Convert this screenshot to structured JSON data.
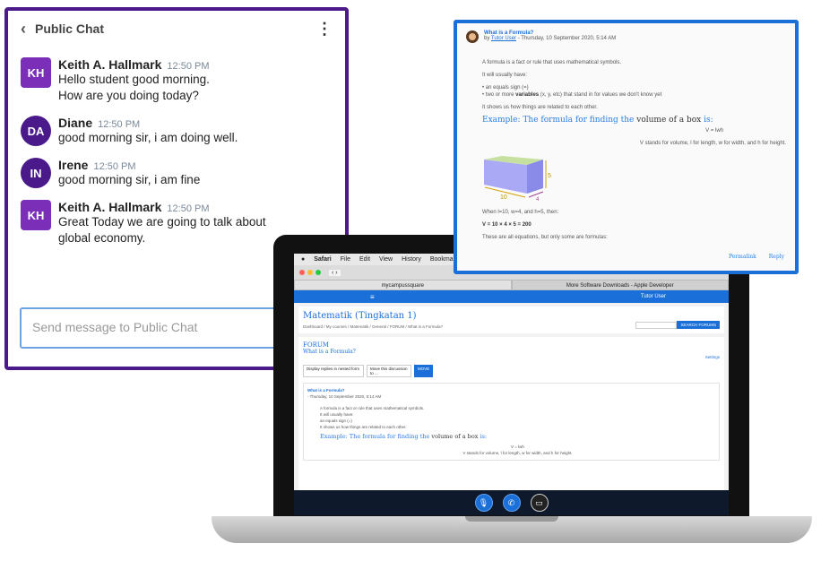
{
  "chat": {
    "title": "Public Chat",
    "messages": [
      {
        "initials": "KH",
        "name": "Keith A. Hallmark",
        "time": "12:50 PM",
        "lines": [
          "Hello student good morning.",
          "How are you doing today?"
        ],
        "color": "#7b2fb8"
      },
      {
        "initials": "DA",
        "name": "Diane",
        "time": "12:50 PM",
        "lines": [
          "good morning sir, i am doing well."
        ],
        "color": "#4a1a8a"
      },
      {
        "initials": "IN",
        "name": "Irene",
        "time": "12:50 PM",
        "lines": [
          "good morning sir, i am fine"
        ],
        "color": "#4a1a8a"
      },
      {
        "initials": "KH",
        "name": "Keith A. Hallmark",
        "time": "12:50 PM",
        "lines": [
          "Great Today we are going to talk about",
          "global economy."
        ],
        "color": "#7b2fb8"
      }
    ],
    "input_placeholder": "Send message to Public Chat"
  },
  "browser": {
    "menu": [
      "Safari",
      "File",
      "Edit",
      "View",
      "History",
      "Bookmarks"
    ],
    "tabs": [
      "mycampussquare",
      "More Software Downloads - Apple Developer"
    ],
    "user": "Tutor User"
  },
  "course": {
    "title": "Matematik (Tingkatan 1)",
    "breadcrumb": "Dashboard / My courses / Matematik / General / FORUM / What is a Formula?",
    "search_button": "SEARCH FORUMS",
    "forum": "FORUM",
    "discussion": "What is a Formula?",
    "settings": "Settings",
    "display_select": "Display replies in nested form",
    "move_select": "Move this discussion to ...",
    "move_button": "MOVE"
  },
  "post": {
    "title": "What is a Formula?",
    "by": "by",
    "author": "Tutor User",
    "date": "- Thursday, 10 September 2020, 5:14 AM",
    "p1": "A formula is a fact or rule that uses mathematical symbols.",
    "p2": "It will usually have:",
    "bullet1": "an equals sign (=)",
    "bullet2_pre": "two or more ",
    "bullet2_bold": "variables",
    "bullet2_post": " (x, y, etc) that stand in for values we don't know yet",
    "p3": "It shows us how things are related to each other.",
    "example_pre": "Example: The formula for finding the",
    "example_mid": " volume of a box ",
    "example_post": "is:",
    "formula": "V = lwh",
    "legend": "V stands for volume, l for length, w for width, and h for height.",
    "box_labels": {
      "length": "10",
      "width": "4",
      "height": "5"
    },
    "when": "When l=10, w=4, and h=5, then:",
    "calc": "V = 10 × 4 × 5 = 200",
    "p4": "These are all equations, but only some are formulas:",
    "permalink": "Permalink",
    "reply": "Reply"
  },
  "controls": {
    "icons": [
      "microphone-icon",
      "phone-icon",
      "screen-share-icon"
    ]
  }
}
